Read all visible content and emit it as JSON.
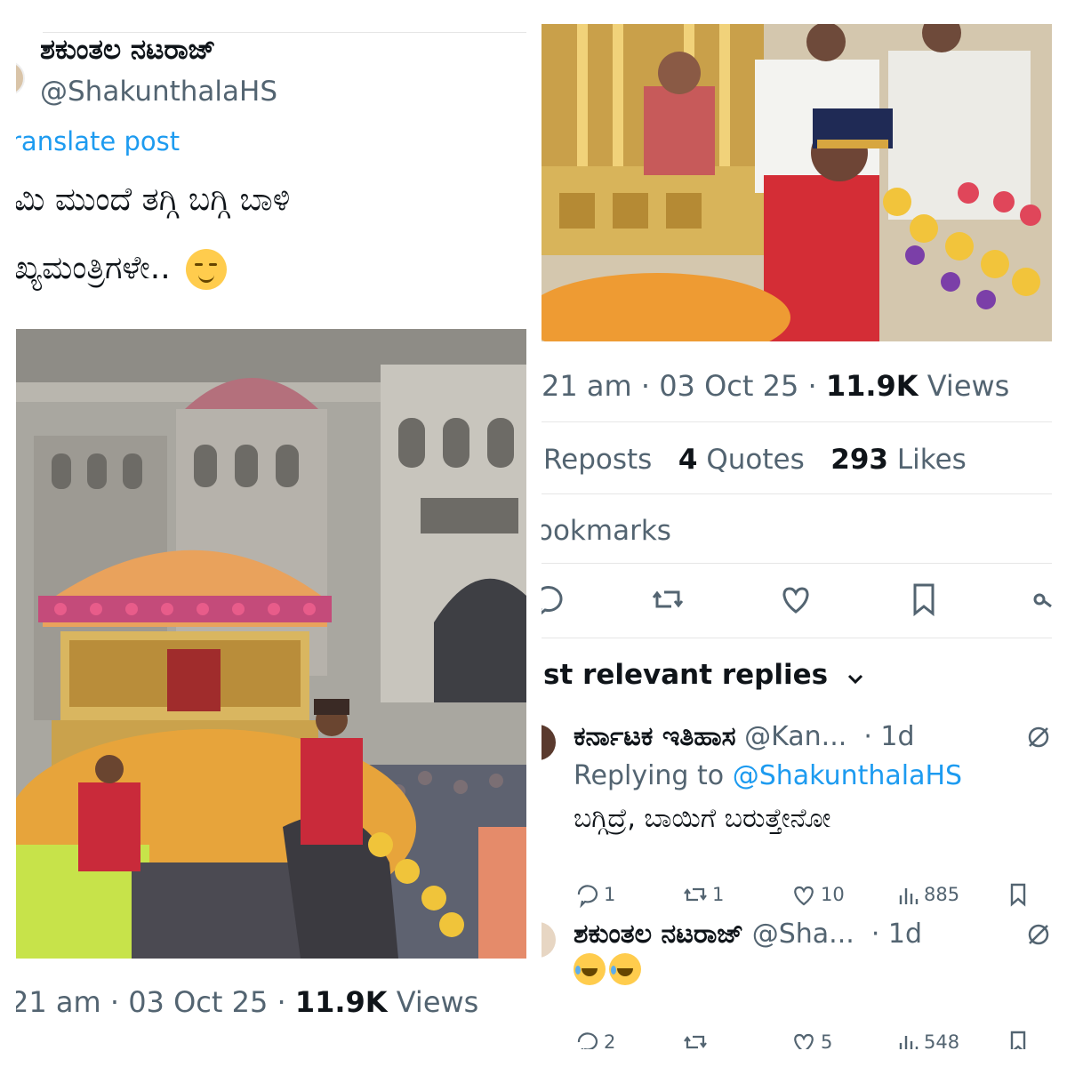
{
  "left": {
    "display_name": "ಶಕುಂತಲ ನಟರಾಜ್",
    "handle": "@ShakunthalaHS",
    "translate_link": "ranslate post",
    "post_lines": [
      "ಮಿ ಮುಂದೆ ತಗ್ಗಿ ಬಗ್ಗಿ ಬಾಳಿ",
      "ಖ್ಯಮಂತ್ರಿಗಳೇ.."
    ],
    "timestamp": {
      "time": "21 am",
      "sep1": "·",
      "date": "03 Oct 25",
      "sep2": "·",
      "views_count": "11.9K",
      "views_label": "Views"
    }
  },
  "right": {
    "timestamp": {
      "time": "21 am",
      "sep1": "·",
      "date": "03 Oct 25",
      "sep2": "·",
      "views_count": "11.9K",
      "views_label": "Views"
    },
    "stats": {
      "reposts_label": "Reposts",
      "quotes_count": "4",
      "quotes_label": "Quotes",
      "likes_count": "293",
      "likes_label": "Likes"
    },
    "bookmarks_label": "ookmarks",
    "replies_heading": "st relevant replies",
    "replies": [
      {
        "name": "ಕರ್ನಾಟಕ ಇತಿಹಾಸ",
        "handle": "@Kan...",
        "time": "· 1d",
        "replying_prefix": "Replying to",
        "replying_handle": "@ShakunthalaHS",
        "text": "ಬಗ್ಗಿದ್ರೆ, ಬಾಯಿಗೆ ಬರುತ್ತೇನೋ",
        "reply_count": "1",
        "repost_count": "1",
        "like_count": "10",
        "view_count": "885"
      },
      {
        "name": "ಶಕುಂತಲ ನಟರಾಜ್",
        "handle": "@Sha...",
        "time": "· 1d",
        "text": "",
        "reply_count": "2",
        "repost_count": "",
        "like_count": "5",
        "view_count": "548"
      }
    ]
  },
  "colors": {
    "link": "#1d9bf0",
    "secondary_text": "#536471",
    "primary_text": "#0f1419"
  },
  "icons": [
    "reply-icon",
    "repost-icon",
    "like-icon",
    "bookmark-icon",
    "share-icon",
    "views-icon",
    "grok-icon",
    "chevron-down-icon"
  ]
}
